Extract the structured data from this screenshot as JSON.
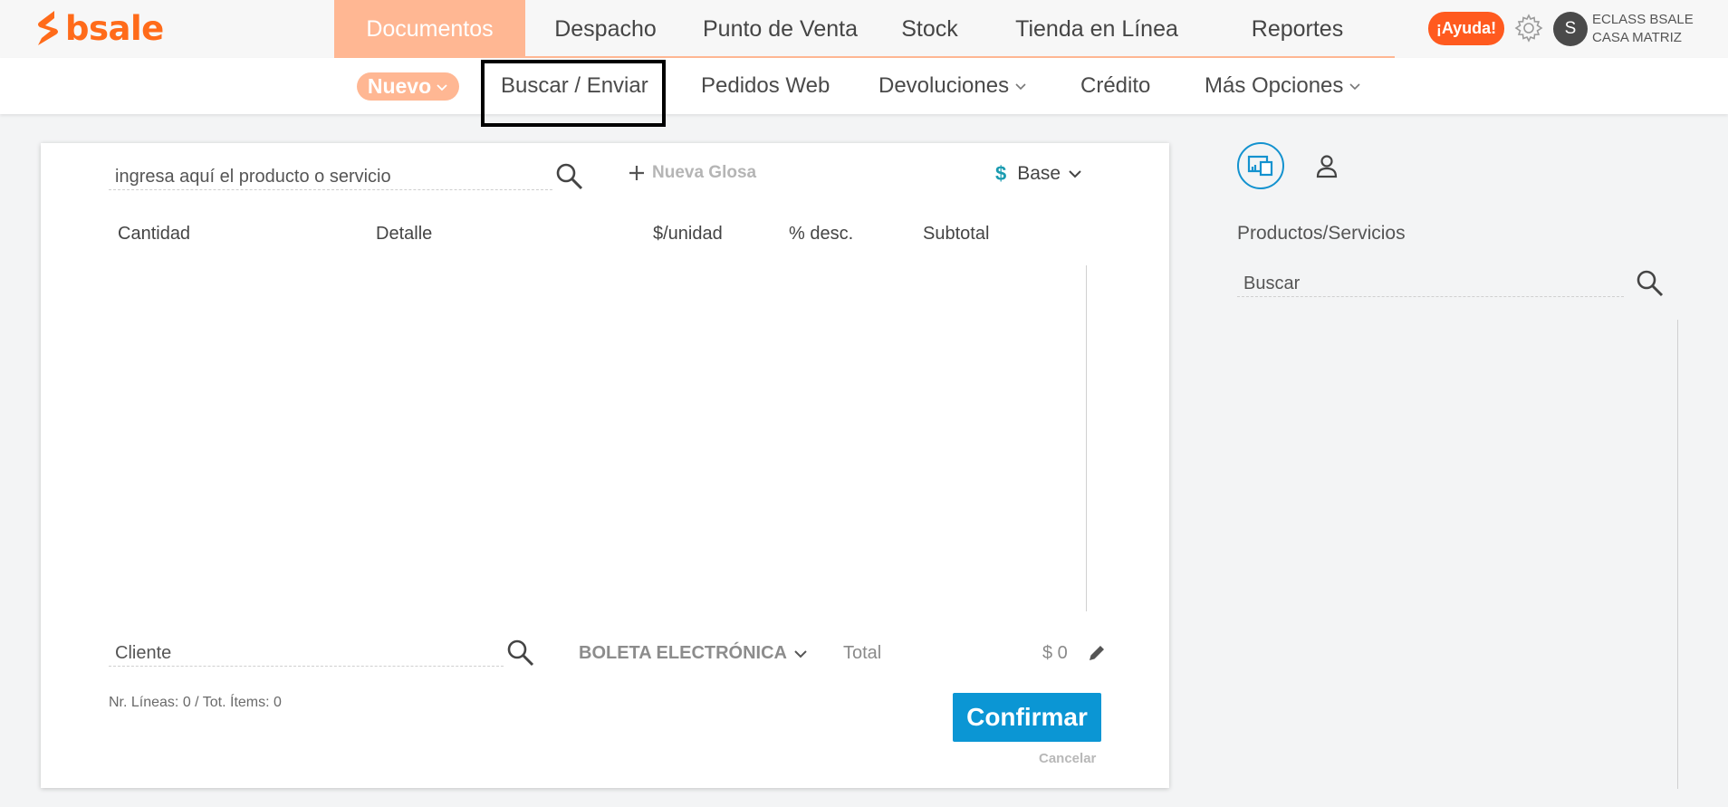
{
  "brand": {
    "name": "bsale",
    "color": "#ff6b1a"
  },
  "header": {
    "nav": [
      {
        "label": "Documentos",
        "active": true
      },
      {
        "label": "Despacho",
        "active": false
      },
      {
        "label": "Punto de Venta",
        "active": false
      },
      {
        "label": "Stock",
        "active": false
      },
      {
        "label": "Tienda en Línea",
        "active": false
      },
      {
        "label": "Reportes",
        "active": false
      }
    ],
    "help_label": "¡Ayuda!",
    "avatar_initial": "S",
    "company_line1": "ECLASS BSALE",
    "company_line2": "CASA MATRIZ"
  },
  "subnav": {
    "nuevo": "Nuevo",
    "buscar_enviar": "Buscar / Enviar",
    "pedidos_web": "Pedidos Web",
    "devoluciones": "Devoluciones",
    "credito": "Crédito",
    "mas_opciones": "Más Opciones"
  },
  "document": {
    "product_search_placeholder": "ingresa aquí el producto o servicio",
    "nueva_glosa": "Nueva Glosa",
    "currency_symbol": "$",
    "price_list": "Base",
    "columns": [
      "Cantidad",
      "Detalle",
      "$/unidad",
      "% desc.",
      "Subtotal"
    ],
    "client_placeholder": "Cliente",
    "doc_type": "BOLETA ELECTRÓNICA",
    "total_label": "Total",
    "total_value": "$ 0",
    "summary": "Nr. Líneas: 0 / Tot. Ítems: 0",
    "confirm": "Confirmar",
    "cancel": "Cancelar"
  },
  "side_panel": {
    "title": "Productos/Servicios",
    "search_placeholder": "Buscar"
  },
  "colors": {
    "accent_orange": "#ffb793",
    "help_orange": "#ff5a1f",
    "primary_blue": "#0b96d4",
    "currency_teal": "#1a9bb0"
  }
}
